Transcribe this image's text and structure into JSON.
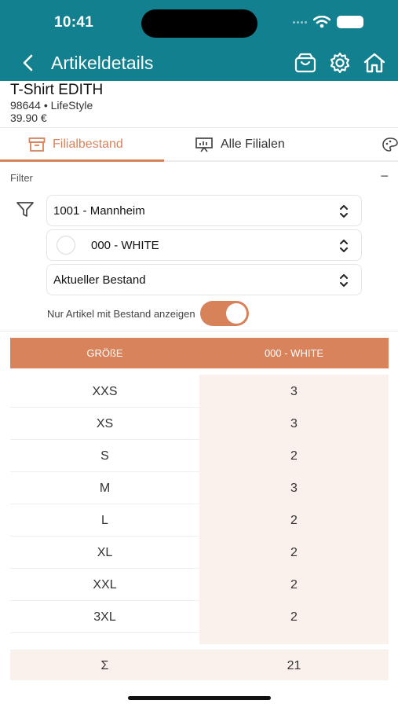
{
  "status_bar": {
    "time": "10:41"
  },
  "nav": {
    "title": "Artikeldetails"
  },
  "product": {
    "name": "T-Shirt EDITH",
    "subtitle": "98644 • LifeStyle",
    "price": "39.90 €"
  },
  "tabs": [
    {
      "label": "Filialbestand",
      "active": true
    },
    {
      "label": "Alle Filialen",
      "active": false
    }
  ],
  "filter": {
    "label": "Filter",
    "collapse_symbol": "−",
    "store_select": "1001 - Mannheim",
    "color_select": "000 - WHITE",
    "stock_select": "Aktueller Bestand",
    "toggle_label": "Nur Artikel mit Bestand anzeigen",
    "toggle_on": true
  },
  "table": {
    "headers": [
      "GRÖßE",
      "000 - WHITE"
    ],
    "rows": [
      {
        "size": "XXS",
        "qty": "3"
      },
      {
        "size": "XS",
        "qty": "3"
      },
      {
        "size": "S",
        "qty": "2"
      },
      {
        "size": "M",
        "qty": "3"
      },
      {
        "size": "L",
        "qty": "2"
      },
      {
        "size": "XL",
        "qty": "2"
      },
      {
        "size": "XXL",
        "qty": "2"
      },
      {
        "size": "3XL",
        "qty": "2"
      }
    ],
    "sum_label": "Σ",
    "sum_value": "21"
  },
  "colors": {
    "header_bg": "#12808e",
    "accent": "#d8825a",
    "cell_tint": "#faf1ec"
  },
  "icons": [
    "back-icon",
    "basket-icon",
    "gear-icon",
    "home-icon",
    "box-icon",
    "presentation-icon",
    "palette-icon",
    "filter-icon",
    "chevron-updown-icon"
  ]
}
